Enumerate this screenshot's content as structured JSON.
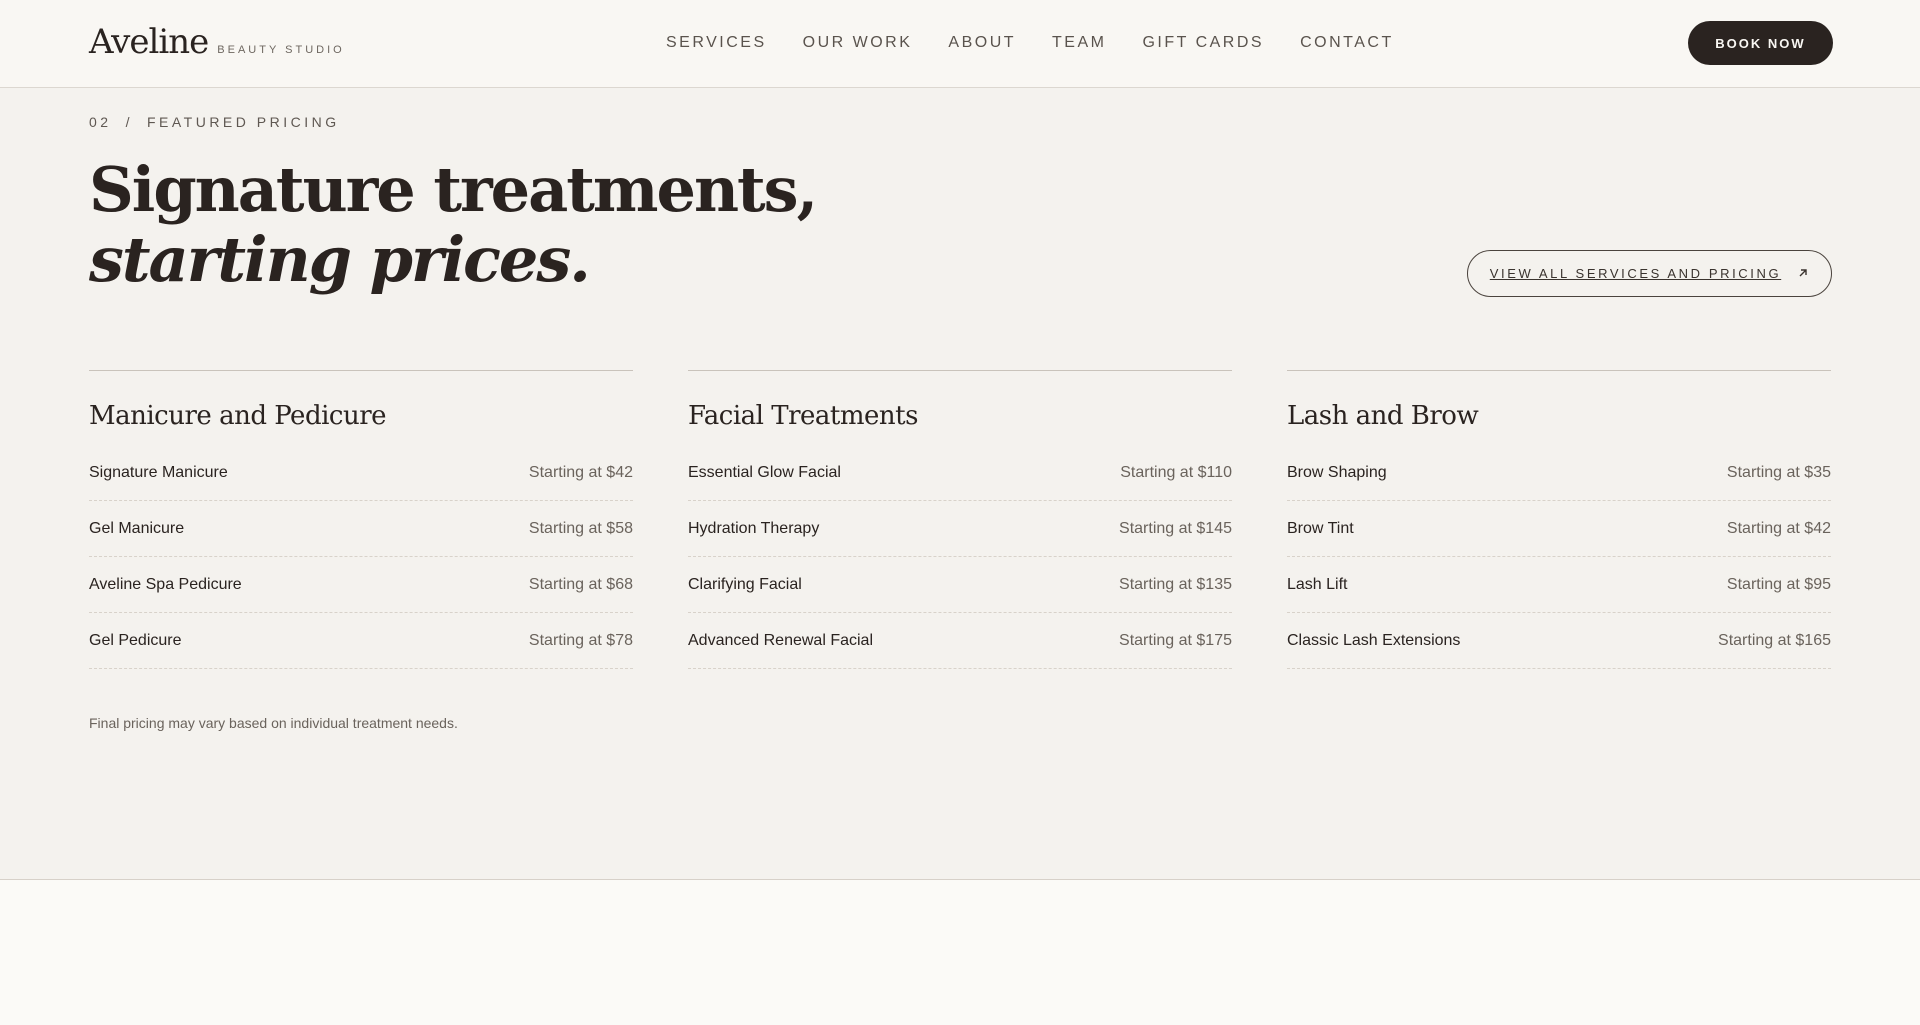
{
  "header": {
    "logo_name": "Aveline",
    "logo_sub": "BEAUTY STUDIO",
    "nav": [
      "SERVICES",
      "OUR WORK",
      "ABOUT",
      "TEAM",
      "GIFT CARDS",
      "CONTACT"
    ],
    "book_label": "BOOK NOW"
  },
  "section": {
    "number": "02",
    "separator": "/",
    "eyebrow": "FEATURED PRICING",
    "headline_line1": "Signature treatments,",
    "headline_line2": "starting prices.",
    "view_all_label": "VIEW ALL SERVICES AND PRICING",
    "view_all_icon": "arrow-up-right-icon",
    "note": "Final pricing may vary based on individual treatment needs."
  },
  "categories": [
    {
      "title": "Manicure and Pedicure",
      "items": [
        {
          "name": "Signature Manicure",
          "price": "Starting at $42"
        },
        {
          "name": "Gel Manicure",
          "price": "Starting at $58"
        },
        {
          "name": "Aveline Spa Pedicure",
          "price": "Starting at $68"
        },
        {
          "name": "Gel Pedicure",
          "price": "Starting at $78"
        }
      ]
    },
    {
      "title": "Facial Treatments",
      "items": [
        {
          "name": "Essential Glow Facial",
          "price": "Starting at $110"
        },
        {
          "name": "Hydration Therapy",
          "price": "Starting at $145"
        },
        {
          "name": "Clarifying Facial",
          "price": "Starting at $135"
        },
        {
          "name": "Advanced Renewal Facial",
          "price": "Starting at $175"
        }
      ]
    },
    {
      "title": "Lash and Brow",
      "items": [
        {
          "name": "Brow Shaping",
          "price": "Starting at $35"
        },
        {
          "name": "Brow Tint",
          "price": "Starting at $42"
        },
        {
          "name": "Lash Lift",
          "price": "Starting at $95"
        },
        {
          "name": "Classic Lash Extensions",
          "price": "Starting at $165"
        }
      ]
    }
  ],
  "colors": {
    "background": "#f4f2ee",
    "header_background": "#f9f7f3",
    "text_dark": "#2a2320",
    "text_muted": "#6a635c",
    "button_dark": "#2a2320"
  }
}
